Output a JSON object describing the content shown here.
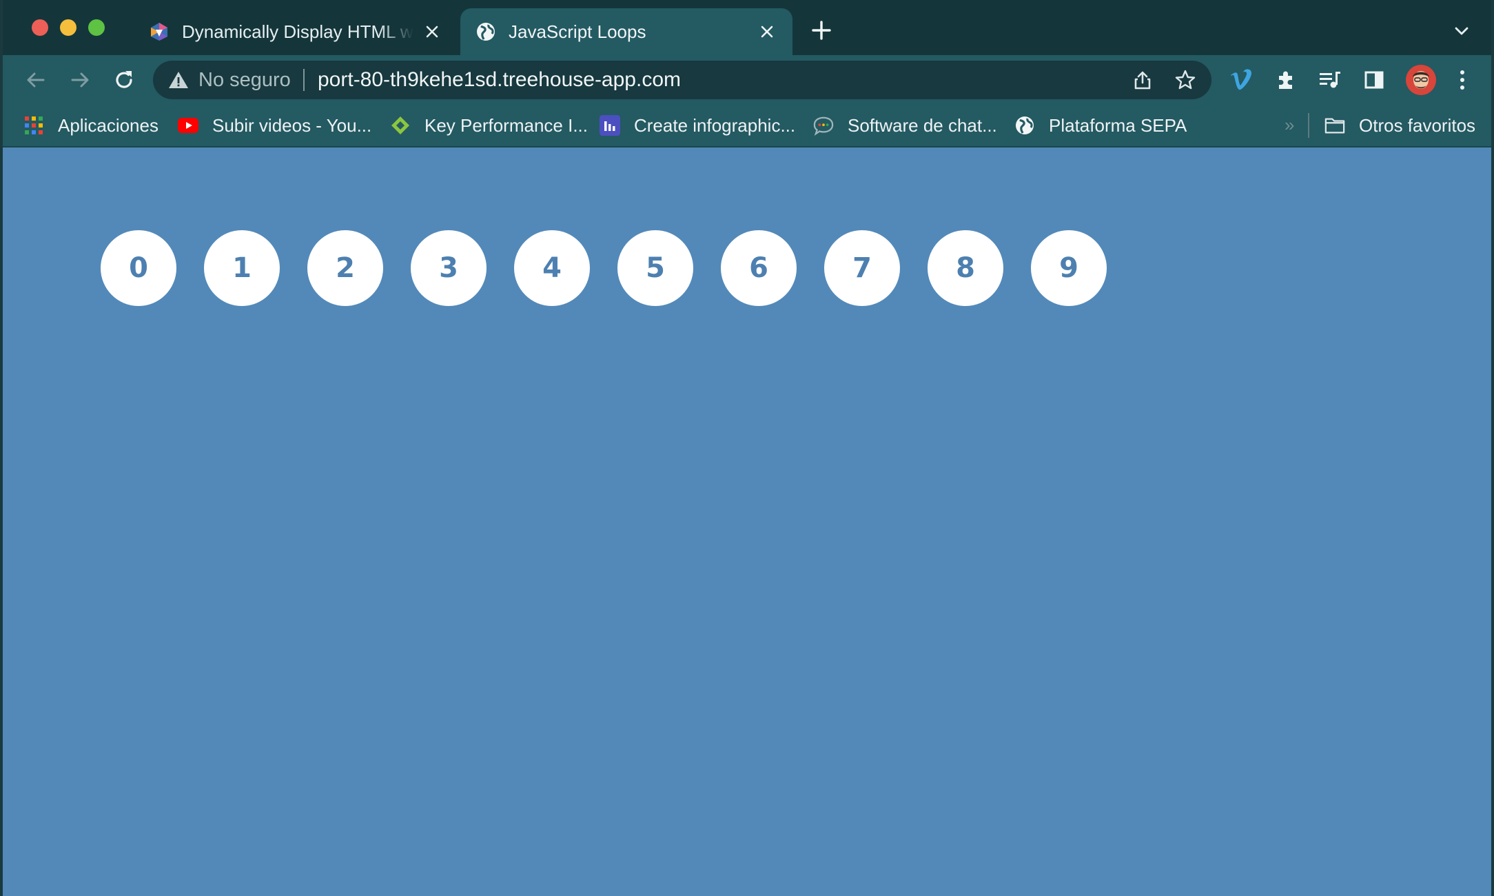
{
  "tabs": [
    {
      "title": "Dynamically Display HTML with a Loop",
      "active": false,
      "icon": "treehouse-icon"
    },
    {
      "title": "JavaScript Loops",
      "active": true,
      "icon": "globe-icon"
    }
  ],
  "omnibox": {
    "security_label": "No seguro",
    "url": "port-80-th9kehe1sd.treehouse-app.com"
  },
  "bookmarks": [
    {
      "label": "Aplicaciones",
      "icon": "apps-grid-icon"
    },
    {
      "label": "Subir videos - You...",
      "icon": "youtube-icon"
    },
    {
      "label": "Key Performance I...",
      "icon": "kpi-diamond-icon"
    },
    {
      "label": "Create infographic...",
      "icon": "infogram-icon"
    },
    {
      "label": "Software de chat...",
      "icon": "chat-bubble-icon"
    },
    {
      "label": "Plataforma SEPA",
      "icon": "globe-icon"
    }
  ],
  "bookmarks_overflow": "»",
  "other_bookmarks": {
    "label": "Otros favoritos",
    "icon": "folder-icon"
  },
  "page": {
    "numbers": [
      "0",
      "1",
      "2",
      "3",
      "4",
      "5",
      "6",
      "7",
      "8",
      "9"
    ]
  },
  "colors": {
    "page_background": "#5289b9",
    "circle_fill": "#ffffff",
    "circle_text": "#4d80b0",
    "toolbar": "#245a62",
    "tabstrip": "#14363b"
  }
}
